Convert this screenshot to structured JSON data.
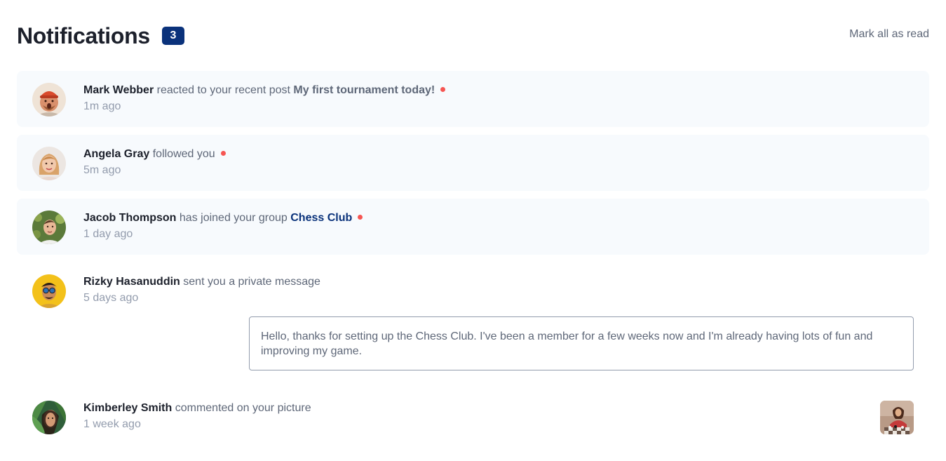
{
  "header": {
    "title": "Notifications",
    "unread_count": "3",
    "mark_all_label": "Mark all as read"
  },
  "notifications": [
    {
      "user": "Mark Webber",
      "action": "reacted to your recent post",
      "target": "My first tournament today!",
      "time": "1m ago",
      "unread": true,
      "avatar_icon": "avatar-mark-webber"
    },
    {
      "user": "Angela Gray",
      "action": "followed you",
      "time": "5m ago",
      "unread": true,
      "avatar_icon": "avatar-angela-gray"
    },
    {
      "user": "Jacob Thompson",
      "action": "has joined your group",
      "target": "Chess Club",
      "time": "1 day ago",
      "unread": true,
      "avatar_icon": "avatar-jacob-thompson"
    },
    {
      "user": "Rizky Hasanuddin",
      "action": "sent you a private message",
      "time": "5 days ago",
      "unread": false,
      "avatar_icon": "avatar-rizky-hasanuddin",
      "message": "Hello, thanks for setting up the Chess Club. I've been a member for a few weeks now and I'm already having lots of fun and improving my game."
    },
    {
      "user": "Kimberley Smith",
      "action": "commented on your picture",
      "time": "1 week ago",
      "unread": false,
      "avatar_icon": "avatar-kimberley-smith",
      "picture_icon": "chess-picture-thumbnail"
    }
  ],
  "colors": {
    "unread_background": "#f7fafd",
    "unread_dot": "#f65552",
    "badge": "#0a327b",
    "group_link": "#0a327b",
    "heading": "#1c202b",
    "body_text": "#5e6778",
    "muted_text": "#939cad"
  }
}
